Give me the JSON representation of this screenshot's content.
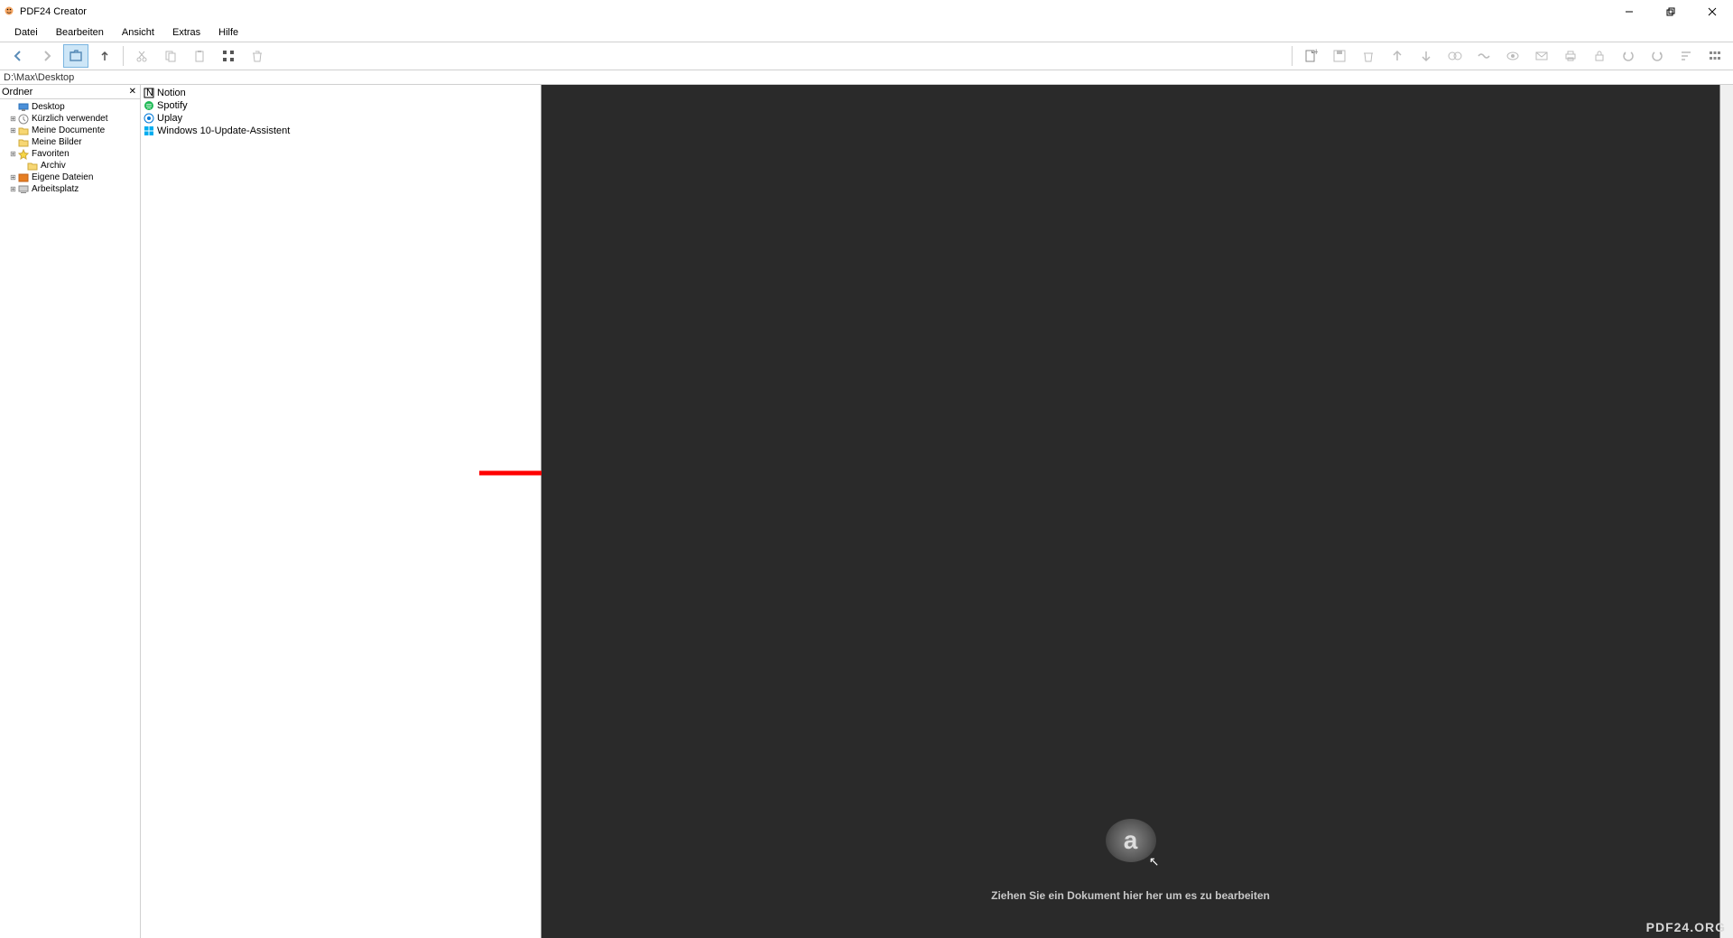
{
  "app": {
    "title": "PDF24 Creator"
  },
  "menu": {
    "items": [
      "Datei",
      "Bearbeiten",
      "Ansicht",
      "Extras",
      "Hilfe"
    ]
  },
  "path": "D:\\Max\\Desktop",
  "tree": {
    "header": "Ordner",
    "nodes": [
      {
        "label": "Desktop",
        "indent": 1,
        "icon": "desktop",
        "expandable": false
      },
      {
        "label": "Kürzlich verwendet",
        "indent": 1,
        "icon": "recent",
        "expandable": true
      },
      {
        "label": "Meine Documente",
        "indent": 1,
        "icon": "folder",
        "expandable": true
      },
      {
        "label": "Meine Bilder",
        "indent": 1,
        "icon": "folder",
        "expandable": false
      },
      {
        "label": "Favoriten",
        "indent": 1,
        "icon": "star",
        "expandable": true
      },
      {
        "label": "Archiv",
        "indent": 2,
        "icon": "folder",
        "expandable": false
      },
      {
        "label": "Eigene Dateien",
        "indent": 1,
        "icon": "folder-box",
        "expandable": true
      },
      {
        "label": "Arbeitsplatz",
        "indent": 1,
        "icon": "computer",
        "expandable": true
      }
    ]
  },
  "files": [
    {
      "label": "Notion",
      "icon": "notion"
    },
    {
      "label": "Spotify",
      "icon": "spotify"
    },
    {
      "label": "Uplay",
      "icon": "uplay"
    },
    {
      "label": "Windows 10-Update-Assistent",
      "icon": "windows"
    }
  ],
  "dropzone": {
    "hint": "Ziehen Sie ein Dokument hier her um es zu bearbeiten"
  },
  "watermark": "PDF24.ORG"
}
